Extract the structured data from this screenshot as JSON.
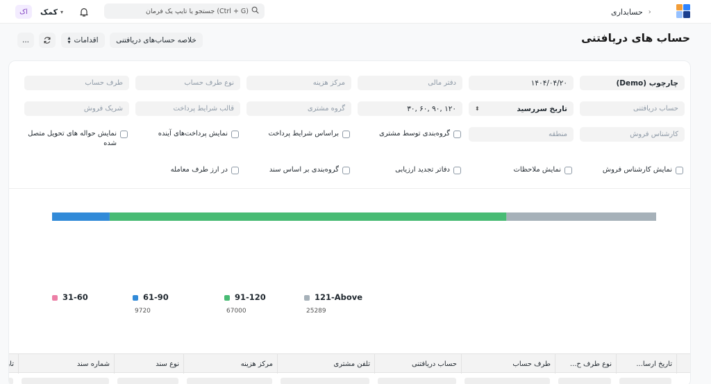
{
  "navbar": {
    "avatar_text": "اک",
    "help_label": "کمک",
    "search_placeholder": "جستجو یا تایپ یک فرمان (Ctrl + G)",
    "breadcrumb": [
      "حسابداری"
    ],
    "colors": {
      "logo_orange": "#f29d38",
      "logo_blue": "#2e84ff",
      "logo_navy": "#1a3f8f"
    }
  },
  "page": {
    "title": "حساب های دریافتنی",
    "buttons": {
      "summary": "خلاصه حساب‌های دریافتنی",
      "actions": "اقدامات",
      "more": "..."
    }
  },
  "filters": {
    "row1": [
      {
        "placeholder": "چارچوب (Demo)",
        "filled": true
      },
      {
        "placeholder": "۱۴۰۴/۰۴/۲۰",
        "filled": true
      },
      {
        "placeholder": "دفتر مالی",
        "filled": false
      },
      {
        "placeholder": "مرکز هزینه",
        "filled": false
      },
      {
        "placeholder": "نوع طرف حساب",
        "filled": false
      },
      {
        "placeholder": "طرف حساب",
        "filled": false
      }
    ],
    "row2": [
      {
        "placeholder": "حساب دریافتنی",
        "filled": false
      },
      {
        "placeholder": "تاریخ سررسید",
        "filled": true
      },
      {
        "placeholder": "۳۰, ۶۰, ۹۰, ۱۲۰",
        "filled": true
      },
      {
        "placeholder": "گروه مشتری",
        "filled": false
      },
      {
        "placeholder": "قالب شرایط پرداخت",
        "filled": false
      },
      {
        "placeholder": "شریک فروش",
        "filled": false
      }
    ],
    "row3": [
      {
        "placeholder": "کارشناس فروش",
        "filled": false
      },
      {
        "placeholder": "منطقه",
        "filled": false
      }
    ],
    "checks_row1": [
      "گروه‌بندی توسط مشتری",
      "براساس شرایط پرداخت",
      "نمایش پرداخت‌های آینده",
      "نمایش حواله های تحویل متصل شده"
    ],
    "checks_row2": [
      "نمایش کارشناس فروش",
      "نمایش ملاحظات",
      "دفاتر تجدید ارزیابی",
      "گروه‌بندی بر اساس سند",
      "در ارز طرف معامله"
    ]
  },
  "chart_data": {
    "type": "bar",
    "orientation": "horizontal-stacked",
    "series": [
      {
        "name": "121-Above",
        "value": 25289,
        "color": "#a6b1b9"
      },
      {
        "name": "91-120",
        "value": 67000,
        "color": "#48bb74"
      },
      {
        "name": "61-90",
        "value": 9720,
        "color": "#318ad8"
      },
      {
        "name": "31-60",
        "value": 0,
        "color": "#ec7fa6"
      }
    ],
    "legend_placement": "bottom"
  },
  "table": {
    "columns": [
      "تاریخ ارسا...",
      "نوع طرف ح...",
      "طرف حساب",
      "حساب دریافتنی",
      "تلفن مشتری",
      "مرکز هزینه",
      "نوع سند",
      "شماره سند",
      "تاریخ سرر...",
      "مقد"
    ]
  }
}
